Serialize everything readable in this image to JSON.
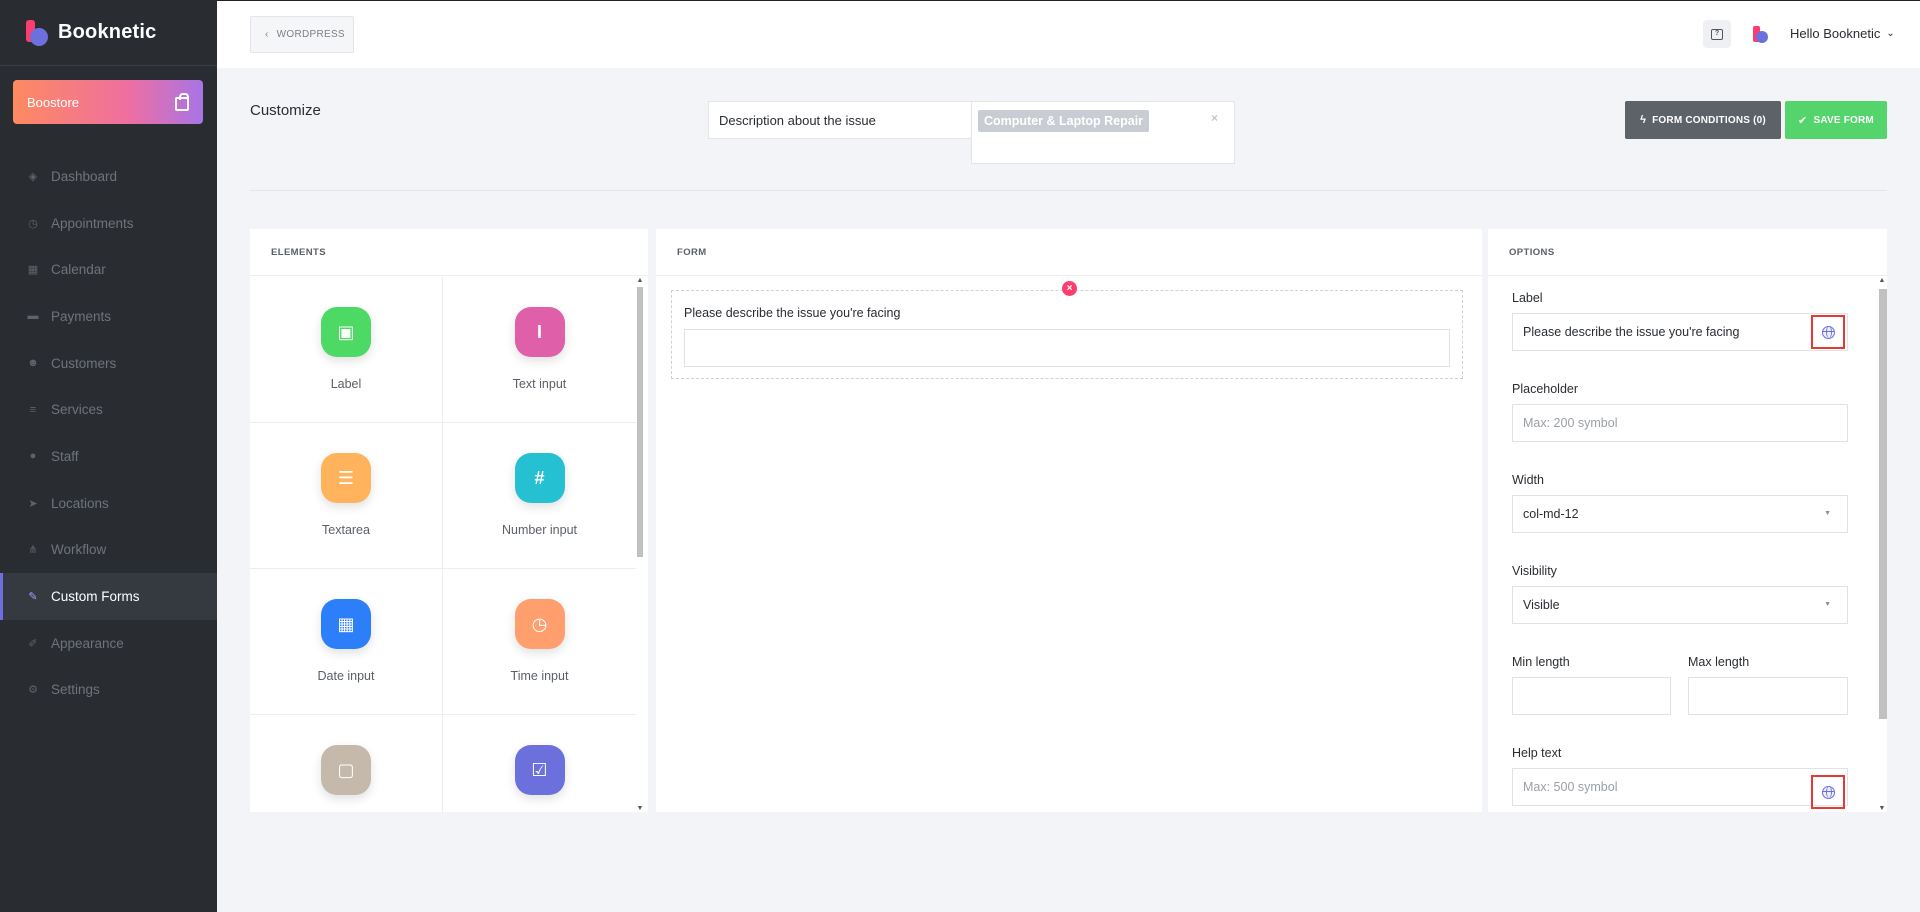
{
  "brand": {
    "name": "Booknetic"
  },
  "boostore": {
    "label": "Boostore"
  },
  "nav": [
    {
      "label": "Dashboard",
      "icon": "cube-icon",
      "glyph": "◈"
    },
    {
      "label": "Appointments",
      "icon": "clock-icon",
      "glyph": "◷"
    },
    {
      "label": "Calendar",
      "icon": "calendar-icon",
      "glyph": "▦"
    },
    {
      "label": "Payments",
      "icon": "credit-card-icon",
      "glyph": "▬"
    },
    {
      "label": "Customers",
      "icon": "users-icon",
      "glyph": "☻"
    },
    {
      "label": "Services",
      "icon": "list-icon",
      "glyph": "≡"
    },
    {
      "label": "Staff",
      "icon": "user-icon",
      "glyph": "●"
    },
    {
      "label": "Locations",
      "icon": "location-arrow-icon",
      "glyph": "➤"
    },
    {
      "label": "Workflow",
      "icon": "workflow-icon",
      "glyph": "⋔"
    },
    {
      "label": "Custom Forms",
      "icon": "magic-wand-icon",
      "glyph": "✎",
      "active": true
    },
    {
      "label": "Appearance",
      "icon": "brush-icon",
      "glyph": "✐"
    },
    {
      "label": "Settings",
      "icon": "gear-icon",
      "glyph": "⚙"
    }
  ],
  "header": {
    "back_label": "WORDPRESS",
    "greeting": "Hello Booknetic"
  },
  "toolbar": {
    "title": "Customize",
    "form_name": "Description about the issue",
    "service_chip": "Computer & Laptop Repair",
    "service_clear": "×",
    "conditions_label": "FORM CONDITIONS (0)",
    "save_label": "SAVE FORM"
  },
  "elements": {
    "title": "ELEMENTS",
    "items": [
      {
        "label": "Label",
        "icon": "label-icon",
        "color": "#4cd964",
        "glyph": "▣"
      },
      {
        "label": "Text input",
        "icon": "text-input-icon",
        "color": "#e05fa9",
        "glyph": "I"
      },
      {
        "label": "Textarea",
        "icon": "textarea-icon",
        "color": "#ffb35c",
        "glyph": "☰"
      },
      {
        "label": "Number input",
        "icon": "hash-icon",
        "color": "#26c0d3",
        "glyph": "#"
      },
      {
        "label": "Date input",
        "icon": "calendar-icon",
        "color": "#2d7ff9",
        "glyph": "▦"
      },
      {
        "label": "Time input",
        "icon": "clock-icon",
        "color": "#ff9f6e",
        "glyph": "◷"
      },
      {
        "label": "",
        "icon": "file-icon",
        "color": "#c4b9aa",
        "glyph": "▢"
      },
      {
        "label": "",
        "icon": "checkbox-icon",
        "color": "#6c70dc",
        "glyph": "☑"
      }
    ]
  },
  "form": {
    "title": "FORM",
    "field_label": "Please describe the issue you're facing",
    "remove_glyph": "×"
  },
  "options": {
    "title": "OPTIONS",
    "label_title": "Label",
    "label_value": "Please describe the issue you're facing",
    "placeholder_title": "Placeholder",
    "placeholder_value": "Max: 200 symbol",
    "width_title": "Width",
    "width_value": "col-md-12",
    "visibility_title": "Visibility",
    "visibility_value": "Visible",
    "min_title": "Min length",
    "max_title": "Max length",
    "help_title": "Help text",
    "help_value": "Max: 500 symbol"
  }
}
